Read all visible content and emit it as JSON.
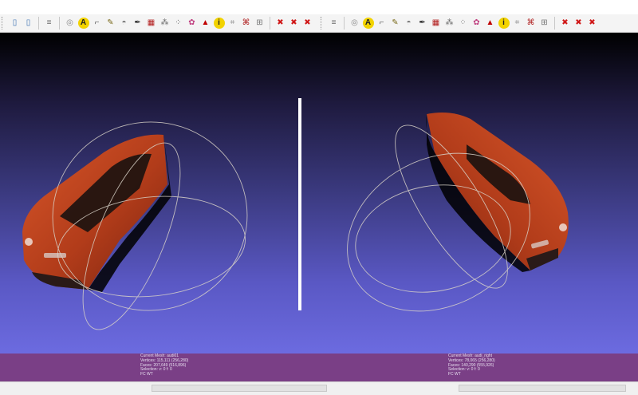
{
  "colors": {
    "background_top": "#000000",
    "background_bottom": "#6c6be0",
    "status_band": "#7a3f86",
    "mesh_body": "#c0441f",
    "trackball": "#d8d2c8"
  },
  "toolbar_left": [
    {
      "name": "view-mode-icon-a",
      "glyph": "▯",
      "color": "#3a6fb0"
    },
    {
      "name": "view-mode-icon-b",
      "glyph": "▯",
      "color": "#3a6fb0"
    },
    {
      "name": "sep"
    },
    {
      "name": "stack-icon",
      "glyph": "≡",
      "color": "#666666"
    },
    {
      "name": "sep"
    },
    {
      "name": "sphere-icon",
      "glyph": "◎",
      "color": "#888888"
    },
    {
      "name": "annotation-a-icon",
      "glyph": "A",
      "color": "#222222",
      "bg": "#f2d300"
    },
    {
      "name": "pick-tool-icon",
      "glyph": "⌐",
      "color": "#555555"
    },
    {
      "name": "brush-icon",
      "glyph": "✎",
      "color": "#7a6a1a"
    },
    {
      "name": "bucket-icon",
      "glyph": "◓",
      "color": "#777777"
    },
    {
      "name": "pen-icon",
      "glyph": "✒",
      "color": "#333333"
    },
    {
      "name": "texture-icon",
      "glyph": "▦",
      "color": "#b01818"
    },
    {
      "name": "select-vertices-icon",
      "glyph": "⁂",
      "color": "#6a6a6a"
    },
    {
      "name": "select-faces-icon",
      "glyph": "⁘",
      "color": "#6a6a6a"
    },
    {
      "name": "palette-icon",
      "glyph": "✿",
      "color": "#c04080"
    },
    {
      "name": "cone-icon",
      "glyph": "▲",
      "color": "#c00000"
    },
    {
      "name": "info-icon",
      "glyph": "i",
      "color": "#222222",
      "bg": "#f2d300"
    },
    {
      "name": "measure-icon",
      "glyph": "⌗",
      "color": "#888888"
    },
    {
      "name": "edit-paint-icon",
      "glyph": "⌘",
      "color": "#b02020"
    },
    {
      "name": "align-icon",
      "glyph": "⊞",
      "color": "#777777"
    },
    {
      "name": "sep"
    },
    {
      "name": "delete-vertices-icon",
      "glyph": "✖",
      "color": "#d01818"
    },
    {
      "name": "delete-faces-icon",
      "glyph": "✖",
      "color": "#d01818"
    },
    {
      "name": "delete-all-icon",
      "glyph": "✖",
      "color": "#d01818"
    }
  ],
  "toolbar_right": [
    {
      "name": "layers-icon",
      "glyph": "≡",
      "color": "#666666"
    },
    {
      "name": "sep"
    },
    {
      "name": "sphere-icon",
      "glyph": "◎",
      "color": "#888888"
    },
    {
      "name": "annotation-a-icon",
      "glyph": "A",
      "color": "#222222",
      "bg": "#f2d300"
    },
    {
      "name": "pick-tool-icon",
      "glyph": "⌐",
      "color": "#555555"
    },
    {
      "name": "brush-icon",
      "glyph": "✎",
      "color": "#7a6a1a"
    },
    {
      "name": "bucket-icon",
      "glyph": "◓",
      "color": "#777777"
    },
    {
      "name": "pen-icon",
      "glyph": "✒",
      "color": "#333333"
    },
    {
      "name": "texture-icon",
      "glyph": "▦",
      "color": "#b01818"
    },
    {
      "name": "select-vertices-icon",
      "glyph": "⁂",
      "color": "#6a6a6a"
    },
    {
      "name": "select-faces-icon",
      "glyph": "⁘",
      "color": "#6a6a6a"
    },
    {
      "name": "palette-icon",
      "glyph": "✿",
      "color": "#c04080"
    },
    {
      "name": "cone-icon",
      "glyph": "▲",
      "color": "#c00000"
    },
    {
      "name": "info-icon",
      "glyph": "i",
      "color": "#222222",
      "bg": "#f2d300"
    },
    {
      "name": "measure-icon",
      "glyph": "⌗",
      "color": "#888888"
    },
    {
      "name": "edit-paint-icon",
      "glyph": "⌘",
      "color": "#b02020"
    },
    {
      "name": "align-icon",
      "glyph": "⊞",
      "color": "#777777"
    },
    {
      "name": "sep"
    },
    {
      "name": "delete-vertices-icon",
      "glyph": "✖",
      "color": "#d01818"
    },
    {
      "name": "delete-faces-icon",
      "glyph": "✖",
      "color": "#d01818"
    },
    {
      "name": "delete-all-icon",
      "glyph": "✖",
      "color": "#d01818"
    }
  ],
  "left_info": {
    "mesh": "Current Mesh: audi01",
    "vertices": "Vertices: 115,111     (256,280)",
    "faces": "Faces: 207,649     (516,896)",
    "selection": "Selection: v: 0 f: 0",
    "vc": "FC WT"
  },
  "right_info": {
    "mesh": "Current Mesh: audi_right",
    "vertices": "Vertices: 78,065     (256,280)",
    "faces": "Faces: 140,290     (555,926)",
    "selection": "Selection: v: 0 f: 0",
    "vc": "FC WT"
  }
}
